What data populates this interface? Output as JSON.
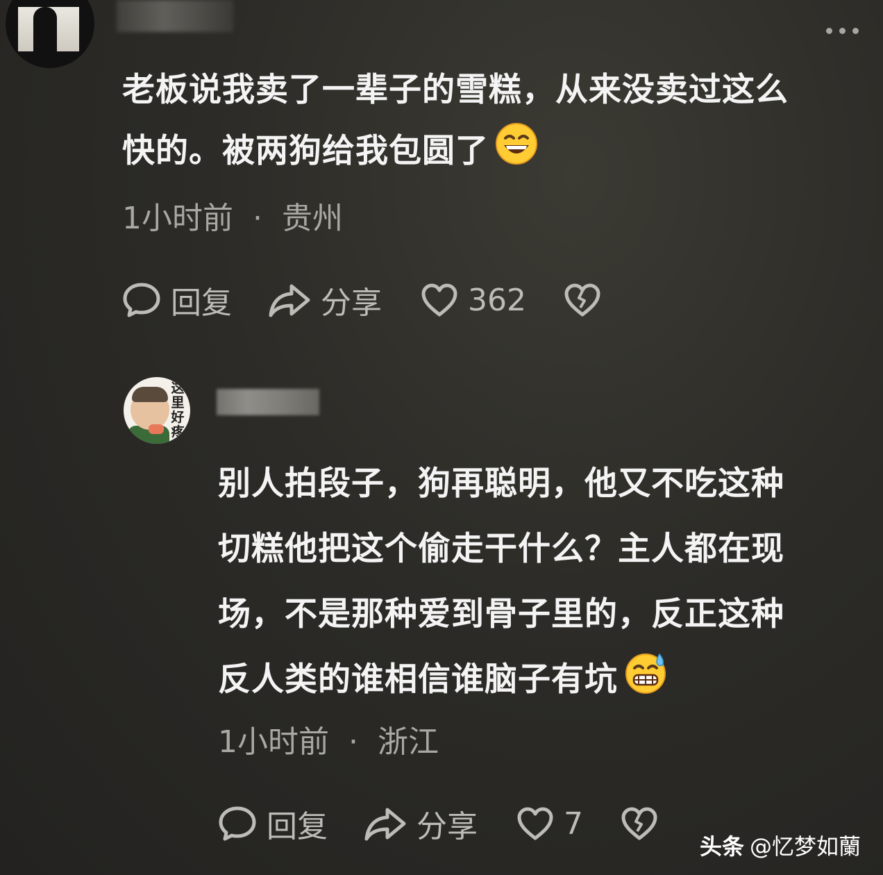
{
  "comment": {
    "text_line1": "老板说我卖了一辈子的雪糕，从来没卖过这么",
    "text_line2": "快的。被两狗给我包圆了",
    "emoji": "grinning-face",
    "time": "1小时前",
    "separator": "·",
    "location": "贵州",
    "reply_label": "回复",
    "share_label": "分享",
    "like_count": "362"
  },
  "reply": {
    "avatar_text": "这里好疼",
    "text_lines": [
      "别人拍段子，狗再聪明，他又不吃这种",
      "切糕他把这个偷走干什么？主人都在现",
      "场，不是那种爱到骨子里的，反正这种",
      "反人类的谁相信谁脑子有坑"
    ],
    "emoji": "grinning-sweat-face",
    "time": "1小时前",
    "separator": "·",
    "location": "浙江",
    "reply_label": "回复",
    "share_label": "分享",
    "like_count": "7"
  },
  "watermark": {
    "brand": "头条",
    "handle": "@忆梦如蘭"
  },
  "colors": {
    "background": "#2c2b27",
    "text": "#f4f4f4",
    "meta": "#a9a8a3",
    "icons": "#bdbcb7"
  }
}
